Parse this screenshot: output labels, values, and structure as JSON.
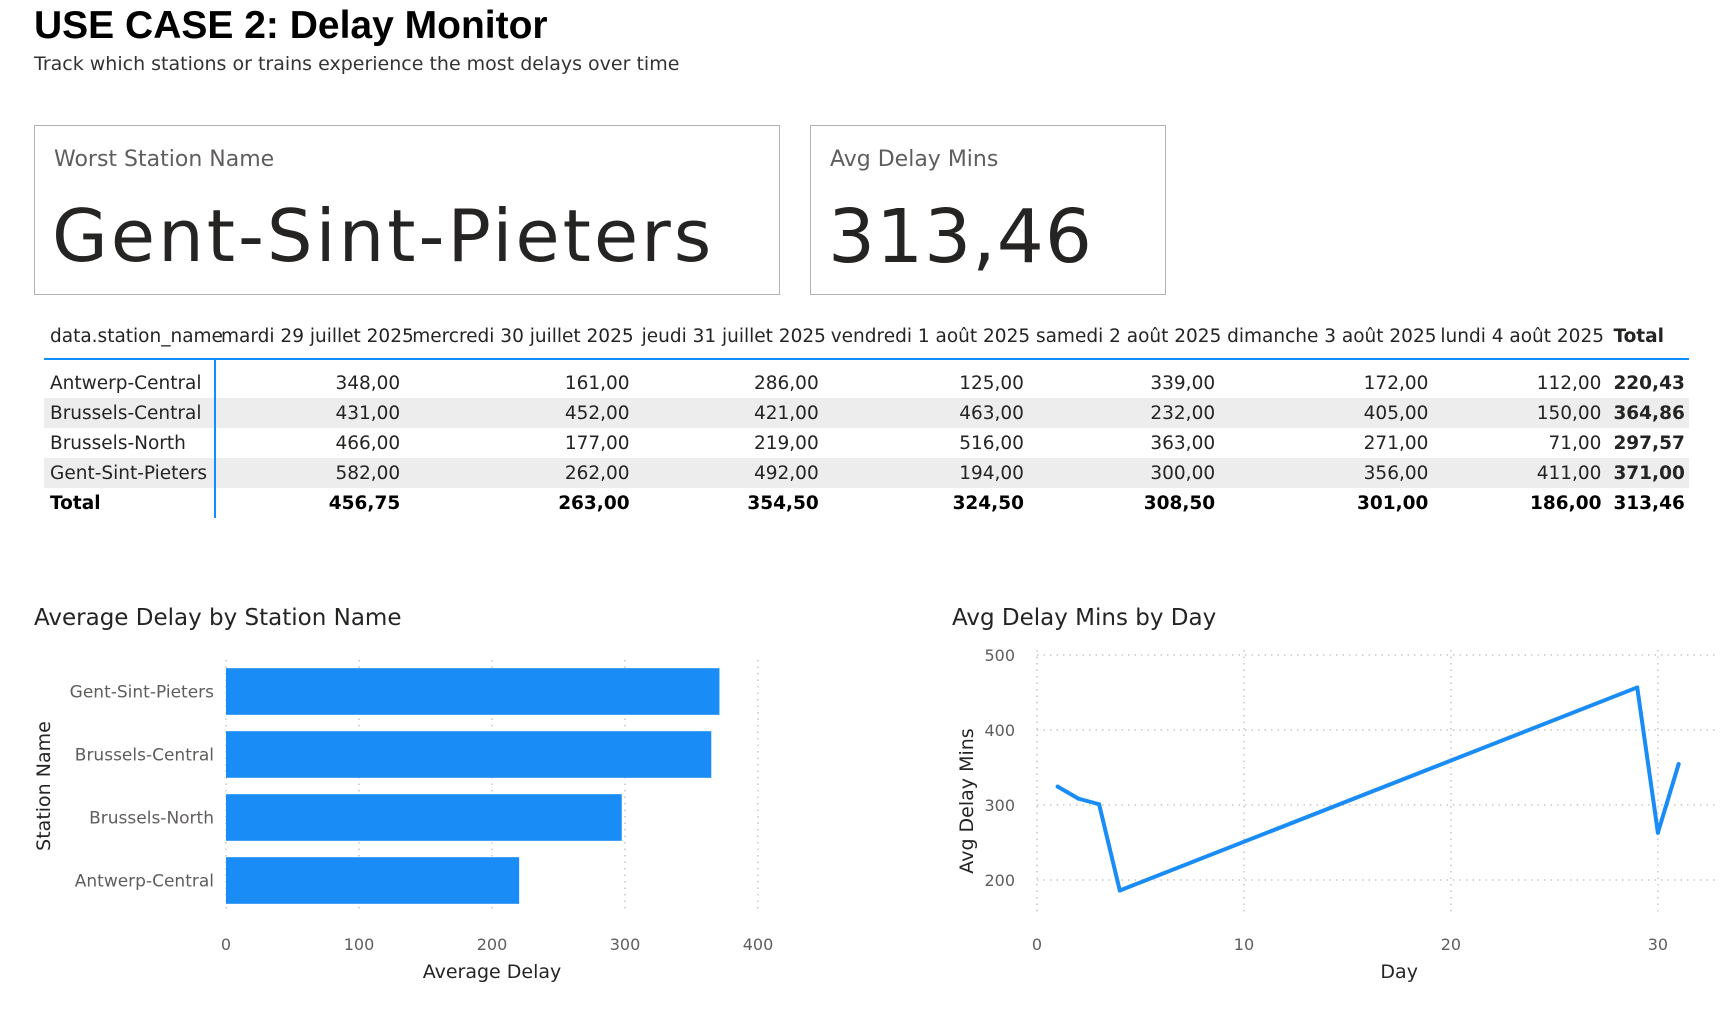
{
  "header": {
    "title": "USE CASE 2: Delay Monitor",
    "subtitle": "Track which stations or trains experience the most delays over time"
  },
  "cards": {
    "worst_station": {
      "label": "Worst Station Name",
      "value": "Gent-Sint-Pieters"
    },
    "avg_delay": {
      "label": "Avg Delay Mins",
      "value": "313,46"
    }
  },
  "matrix": {
    "columns": [
      "data.station_name",
      "mardi 29 juillet 2025",
      "mercredi 30 juillet 2025",
      "jeudi 31 juillet 2025",
      "vendredi 1 août 2025",
      "samedi 2 août 2025",
      "dimanche 3 août 2025",
      "lundi 4 août 2025",
      "Total"
    ],
    "rows": [
      {
        "name": "Antwerp-Central",
        "values": [
          "348,00",
          "161,00",
          "286,00",
          "125,00",
          "339,00",
          "172,00",
          "112,00",
          "220,43"
        ]
      },
      {
        "name": "Brussels-Central",
        "values": [
          "431,00",
          "452,00",
          "421,00",
          "463,00",
          "232,00",
          "405,00",
          "150,00",
          "364,86"
        ]
      },
      {
        "name": "Brussels-North",
        "values": [
          "466,00",
          "177,00",
          "219,00",
          "516,00",
          "363,00",
          "271,00",
          "71,00",
          "297,57"
        ]
      },
      {
        "name": "Gent-Sint-Pieters",
        "values": [
          "582,00",
          "262,00",
          "492,00",
          "194,00",
          "300,00",
          "356,00",
          "411,00",
          "371,00"
        ]
      }
    ],
    "total": {
      "name": "Total",
      "values": [
        "456,75",
        "263,00",
        "354,50",
        "324,50",
        "308,50",
        "301,00",
        "186,00",
        "313,46"
      ]
    }
  },
  "colors": {
    "accent": "#118dff",
    "bar": "#1a8cf5",
    "alt_row": "#ededed",
    "grid": "#c8c6c4"
  },
  "chart_data": [
    {
      "type": "bar",
      "orientation": "horizontal",
      "title": "Average Delay by Station Name",
      "xlabel": "Average Delay",
      "ylabel": "Station Name",
      "categories": [
        "Gent-Sint-Pieters",
        "Brussels-Central",
        "Brussels-North",
        "Antwerp-Central"
      ],
      "values": [
        371.0,
        364.86,
        297.57,
        220.43
      ],
      "xlim": [
        0,
        400
      ],
      "xticks": [
        0,
        100,
        200,
        300,
        400
      ],
      "grid": true
    },
    {
      "type": "line",
      "title": "Avg Delay Mins by Day",
      "xlabel": "Day",
      "ylabel": "Avg Delay Mins",
      "x": [
        1,
        2,
        3,
        4,
        29,
        30,
        31
      ],
      "y": [
        324.5,
        308.5,
        301.0,
        186.0,
        456.75,
        263.0,
        354.5
      ],
      "xlim": [
        0,
        33
      ],
      "ylim": [
        160,
        500
      ],
      "xticks": [
        0,
        10,
        20,
        30
      ],
      "yticks": [
        200,
        300,
        400,
        500
      ],
      "grid": true
    }
  ]
}
